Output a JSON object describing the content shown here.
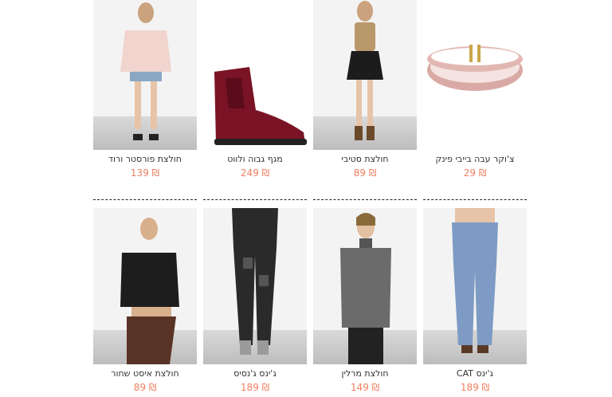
{
  "products_row1": [
    {
      "name": "צ'וקר עבה בייבי פינק",
      "price": "29",
      "currency": "₪"
    },
    {
      "name": "חולצת סטיבי",
      "price": "89",
      "currency": "₪"
    },
    {
      "name": "מגף גבוה ולווט",
      "price": "249",
      "currency": "₪"
    },
    {
      "name": "חולצת פורסטר ורוד",
      "price": "139",
      "currency": "₪"
    }
  ],
  "products_row2": [
    {
      "name": "ג'ינס CAT",
      "price": "189",
      "currency": "₪"
    },
    {
      "name": "חולצת מרלין",
      "price": "149",
      "currency": "₪"
    },
    {
      "name": "ג'ינס ג'נסיס",
      "price": "189",
      "currency": "₪"
    },
    {
      "name": "חולצת איסט שחור",
      "price": "89",
      "currency": "₪"
    }
  ],
  "colors": {
    "price": "#f07f60",
    "name": "#333333"
  }
}
